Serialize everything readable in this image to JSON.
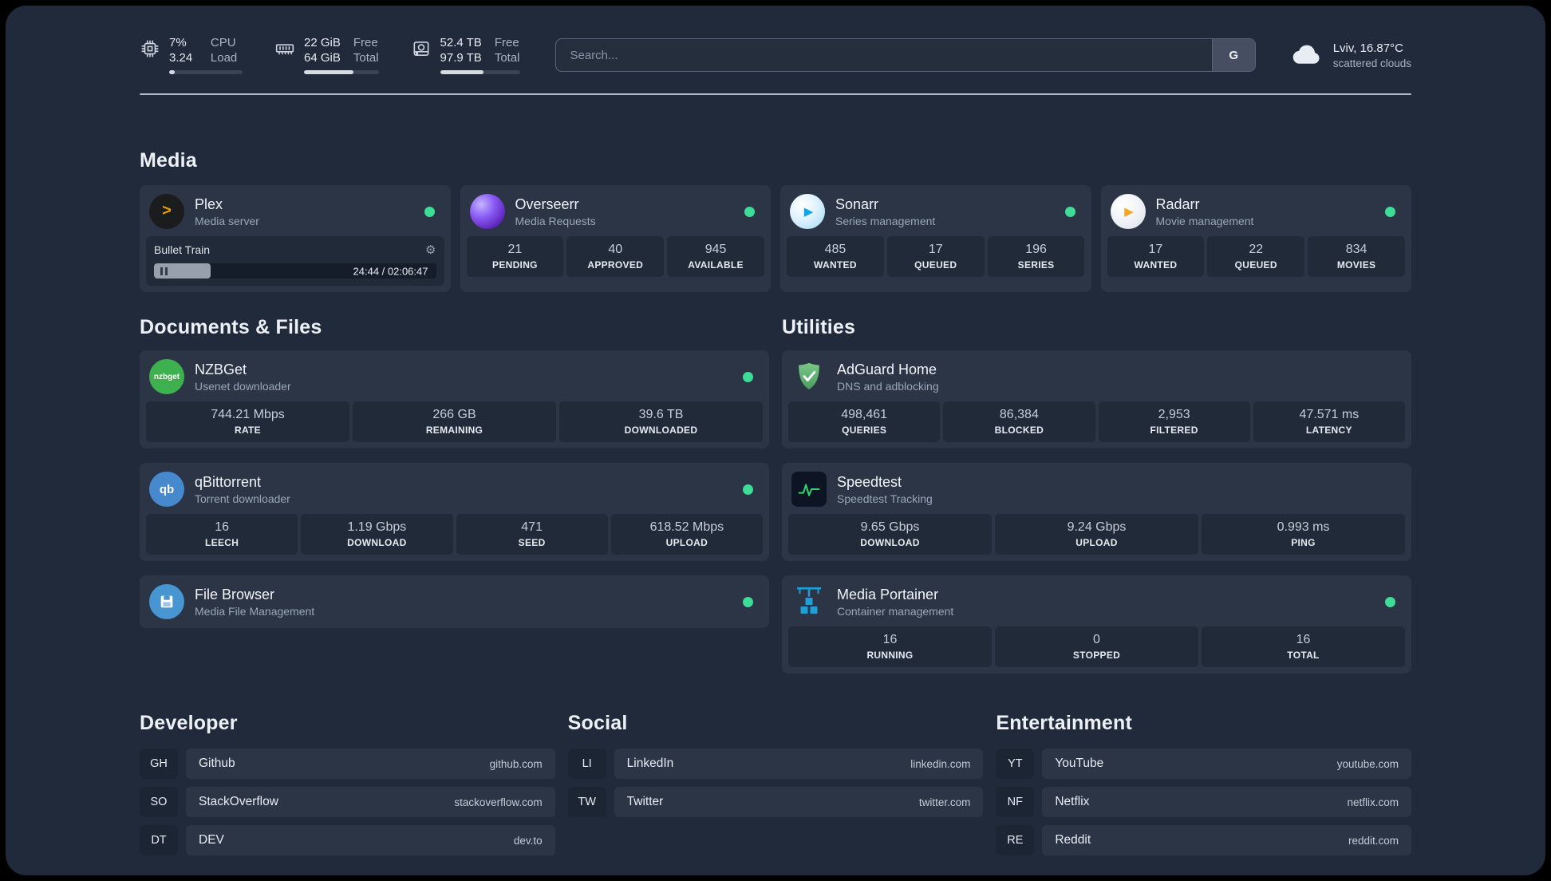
{
  "colors": {
    "page_bg": "#202a3a",
    "card_bg": "#2b3546",
    "stat_bg": "#212a39",
    "status_green": "#3ddc97",
    "accent_plex": "#e5a00d",
    "accent_sonarr": "#0ea5e9",
    "accent_radarr": "#f5a623",
    "nzbget_green": "#3db14d",
    "qbittorrent_blue": "#4689cd",
    "filebrowser_blue": "#4796d2",
    "adguard_green": "#5fae6e",
    "speedtest_green": "#2fd573",
    "portainer_blue": "#1e9fd8"
  },
  "icons": {
    "plex_glyph": ">",
    "sonarr_glyph": "▶",
    "radarr_glyph": "▶",
    "gear_glyph": "⚙",
    "nzbget_text": "nzbget",
    "qbittorrent_text": "qb"
  },
  "topbar": {
    "cpu": {
      "value1": "7%",
      "label1": "CPU",
      "value2": "3.24",
      "label2": "Load",
      "percent": 8
    },
    "memory": {
      "value1": "22 GiB",
      "label1": "Free",
      "value2": "64 GiB",
      "label2": "Total",
      "percent": 66
    },
    "disk": {
      "value1": "52.4 TB",
      "label1": "Free",
      "value2": "97.9 TB",
      "label2": "Total",
      "percent": 54
    },
    "search": {
      "placeholder": "Search...",
      "button_label": "G"
    },
    "weather": {
      "location": "Lviv, 16.87°C",
      "condition": "scattered clouds"
    }
  },
  "media": {
    "title": "Media",
    "plex": {
      "name": "Plex",
      "desc": "Media server",
      "player_title": "Bullet Train",
      "player_time": "24:44 / 02:06:47",
      "progress": 20
    },
    "overseerr": {
      "name": "Overseerr",
      "desc": "Media Requests",
      "stats": [
        {
          "value": "21",
          "label": "PENDING"
        },
        {
          "value": "40",
          "label": "APPROVED"
        },
        {
          "value": "945",
          "label": "AVAILABLE"
        }
      ]
    },
    "sonarr": {
      "name": "Sonarr",
      "desc": "Series management",
      "stats": [
        {
          "value": "485",
          "label": "WANTED"
        },
        {
          "value": "17",
          "label": "QUEUED"
        },
        {
          "value": "196",
          "label": "SERIES"
        }
      ]
    },
    "radarr": {
      "name": "Radarr",
      "desc": "Movie management",
      "stats": [
        {
          "value": "17",
          "label": "WANTED"
        },
        {
          "value": "22",
          "label": "QUEUED"
        },
        {
          "value": "834",
          "label": "MOVIES"
        }
      ]
    }
  },
  "documents": {
    "title": "Documents & Files",
    "nzbget": {
      "name": "NZBGet",
      "desc": "Usenet downloader",
      "stats": [
        {
          "value": "744.21 Mbps",
          "label": "RATE"
        },
        {
          "value": "266 GB",
          "label": "REMAINING"
        },
        {
          "value": "39.6 TB",
          "label": "DOWNLOADED"
        }
      ]
    },
    "qbittorrent": {
      "name": "qBittorrent",
      "desc": "Torrent downloader",
      "stats": [
        {
          "value": "16",
          "label": "LEECH"
        },
        {
          "value": "1.19 Gbps",
          "label": "DOWNLOAD"
        },
        {
          "value": "471",
          "label": "SEED"
        },
        {
          "value": "618.52 Mbps",
          "label": "UPLOAD"
        }
      ]
    },
    "filebrowser": {
      "name": "File Browser",
      "desc": "Media File Management"
    }
  },
  "utilities": {
    "title": "Utilities",
    "adguard": {
      "name": "AdGuard Home",
      "desc": "DNS and adblocking",
      "stats": [
        {
          "value": "498,461",
          "label": "QUERIES"
        },
        {
          "value": "86,384",
          "label": "BLOCKED"
        },
        {
          "value": "2,953",
          "label": "FILTERED"
        },
        {
          "value": "47.571 ms",
          "label": "LATENCY"
        }
      ]
    },
    "speedtest": {
      "name": "Speedtest",
      "desc": "Speedtest Tracking",
      "stats": [
        {
          "value": "9.65 Gbps",
          "label": "DOWNLOAD"
        },
        {
          "value": "9.24 Gbps",
          "label": "UPLOAD"
        },
        {
          "value": "0.993 ms",
          "label": "PING"
        }
      ]
    },
    "portainer": {
      "name": "Media Portainer",
      "desc": "Container management",
      "stats": [
        {
          "value": "16",
          "label": "RUNNING"
        },
        {
          "value": "0",
          "label": "STOPPED"
        },
        {
          "value": "16",
          "label": "TOTAL"
        }
      ]
    }
  },
  "bookmarks": {
    "developer": {
      "title": "Developer",
      "items": [
        {
          "abbr": "GH",
          "name": "Github",
          "domain": "github.com"
        },
        {
          "abbr": "SO",
          "name": "StackOverflow",
          "domain": "stackoverflow.com"
        },
        {
          "abbr": "DT",
          "name": "DEV",
          "domain": "dev.to"
        }
      ]
    },
    "social": {
      "title": "Social",
      "items": [
        {
          "abbr": "LI",
          "name": "LinkedIn",
          "domain": "linkedin.com"
        },
        {
          "abbr": "TW",
          "name": "Twitter",
          "domain": "twitter.com"
        }
      ]
    },
    "entertainment": {
      "title": "Entertainment",
      "items": [
        {
          "abbr": "YT",
          "name": "YouTube",
          "domain": "youtube.com"
        },
        {
          "abbr": "NF",
          "name": "Netflix",
          "domain": "netflix.com"
        },
        {
          "abbr": "RE",
          "name": "Reddit",
          "domain": "reddit.com"
        }
      ]
    }
  }
}
